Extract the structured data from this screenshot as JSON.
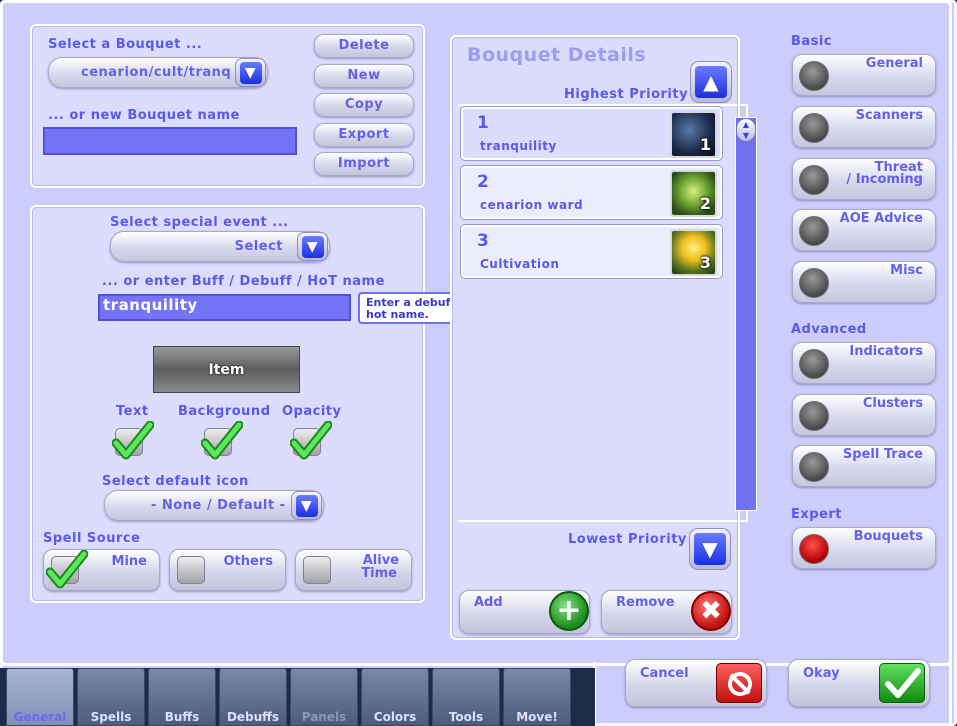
{
  "bouquet_select": {
    "label": "Select a Bouquet ...",
    "selected": "cenarion/cult/tranq",
    "new_label": "... or new Bouquet name",
    "new_value": ""
  },
  "bouquet_actions": [
    "Delete",
    "New",
    "Copy",
    "Export",
    "Import"
  ],
  "event": {
    "label": "Select special event ...",
    "selected": "Select",
    "buff_label": "... or enter Buff / Debuff / HoT name",
    "buff_value": "tranquility",
    "tooltip": "Enter a debuff, buff or hot name."
  },
  "item_button": "Item",
  "toggles": {
    "text": {
      "label": "Text",
      "checked": true
    },
    "background": {
      "label": "Background",
      "checked": true
    },
    "opacity": {
      "label": "Opacity",
      "checked": true
    }
  },
  "default_icon": {
    "label": "Select default icon",
    "selected": "- None / Default -"
  },
  "spell_source": {
    "label": "Spell Source",
    "mine": "Mine",
    "others": "Others",
    "alive_line1": "Alive",
    "alive_line2": "Time"
  },
  "details": {
    "title": "Bouquet Details",
    "highest": "Highest Priority",
    "lowest": "Lowest Priority",
    "add": "Add",
    "remove": "Remove",
    "items": [
      {
        "num": "1",
        "name": "tranquility",
        "icon_num": "1"
      },
      {
        "num": "2",
        "name": "cenarion ward",
        "icon_num": "2"
      },
      {
        "num": "3",
        "name": "Cultivation",
        "icon_num": "3"
      }
    ]
  },
  "sidebar": {
    "basic": "Basic",
    "general": "General",
    "scanners": "Scanners",
    "threat_line1": "Threat",
    "threat_line2": "/ Incoming",
    "aoe": "AOE Advice",
    "misc": "Misc",
    "advanced": "Advanced",
    "indicators": "Indicators",
    "clusters": "Clusters",
    "spelltrace": "Spell Trace",
    "expert": "Expert",
    "bouquets": "Bouquets"
  },
  "footer": {
    "cancel": "Cancel",
    "okay": "Okay"
  },
  "tabs": [
    "General",
    "Spells",
    "Buffs",
    "Debuffs",
    "Panels",
    "Colors",
    "Tools",
    "Move!"
  ]
}
